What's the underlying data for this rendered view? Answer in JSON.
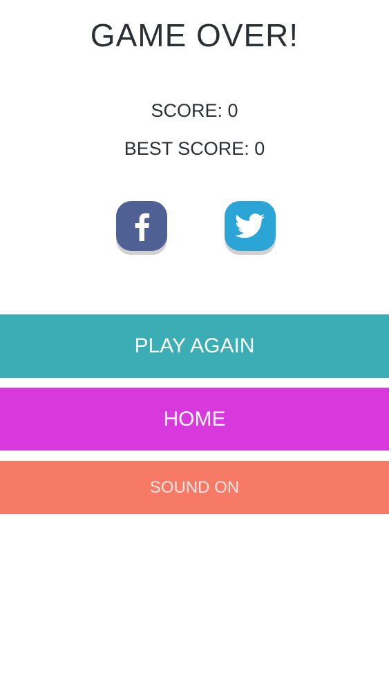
{
  "game_over": {
    "title": "GAME OVER!",
    "score_text": "SCORE: 0",
    "best_score_text": "BEST SCORE: 0"
  },
  "social": {
    "facebook": {
      "icon": "facebook-icon",
      "color": "#4f6194"
    },
    "twitter": {
      "icon": "twitter-icon",
      "color": "#2ba5d6"
    }
  },
  "buttons": {
    "play_again": {
      "label": "PLAY AGAIN",
      "color": "#3cadb5"
    },
    "home": {
      "label": "HOME",
      "color": "#d839dc"
    },
    "sound": {
      "label": "SOUND ON",
      "color": "#f77a66"
    }
  }
}
